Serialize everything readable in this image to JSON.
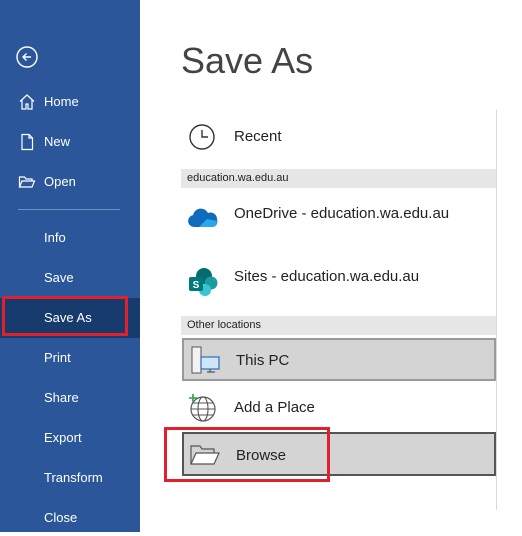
{
  "sidebar": {
    "back": "back-arrow-icon",
    "items_top": [
      {
        "label": "Home",
        "icon": "home-icon"
      },
      {
        "label": "New",
        "icon": "new-document-icon"
      },
      {
        "label": "Open",
        "icon": "folder-open-icon"
      }
    ],
    "items_bottom": [
      {
        "label": "Info"
      },
      {
        "label": "Save"
      },
      {
        "label": "Save As"
      },
      {
        "label": "Print"
      },
      {
        "label": "Share"
      },
      {
        "label": "Export"
      },
      {
        "label": "Transform"
      },
      {
        "label": "Close"
      }
    ]
  },
  "main": {
    "title": "Save As",
    "recent": {
      "label": "Recent",
      "icon": "clock-icon"
    },
    "sections": [
      {
        "header": "education.wa.edu.au",
        "items": [
          {
            "label": "OneDrive - education.wa.edu.au",
            "icon": "onedrive-icon"
          },
          {
            "label": "Sites - education.wa.edu.au",
            "icon": "sharepoint-icon"
          }
        ]
      },
      {
        "header": "Other locations",
        "items": [
          {
            "label": "This PC",
            "icon": "this-pc-icon"
          },
          {
            "label": "Add a Place",
            "icon": "add-place-globe-icon"
          },
          {
            "label": "Browse",
            "icon": "browse-folder-icon"
          }
        ]
      }
    ]
  },
  "colors": {
    "sidebar": "#2b579a",
    "sidebar_active": "#183b6e",
    "highlight": "#e0202a"
  }
}
